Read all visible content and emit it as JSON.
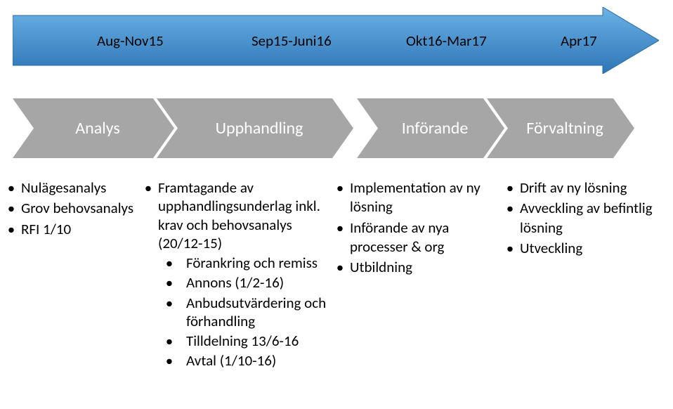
{
  "timeline": {
    "labels": [
      "Aug-Nov15",
      "Sep15-Juni16",
      "Okt16-Mar17",
      "Apr17"
    ]
  },
  "phases": {
    "items": [
      {
        "name": "Analys"
      },
      {
        "name": "Upphandling"
      },
      {
        "name": "Införande"
      },
      {
        "name": "Förvaltning"
      }
    ]
  },
  "columns": [
    {
      "items": [
        "Nulägesanalys",
        "Grov behovsanalys",
        "RFI 1/10"
      ]
    },
    {
      "items": [
        "Framtagande av upphandlingsunderlag inkl. krav och behovsanalys (20/12-15)",
        "Förankring och remiss",
        "Annons (1/2-16)",
        "Anbudsutvärdering och förhandling",
        "Tilldelning 13/6-16",
        "Avtal (1/10-16)"
      ]
    },
    {
      "items": [
        "Implementation av ny lösning",
        "Införande av nya processer & org",
        "Utbildning"
      ]
    },
    {
      "items": [
        "Drift av ny lösning",
        "Avveckling av befintlig lösning",
        "Utveckling"
      ]
    }
  ],
  "colors": {
    "blue_top": "#5BA4DC",
    "blue_bottom": "#2E75B6",
    "blue_stroke": "#2E6CA4",
    "grey": "#A6A6A6"
  }
}
